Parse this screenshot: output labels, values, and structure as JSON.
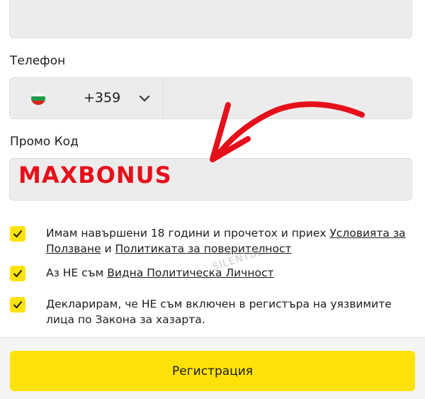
{
  "form": {
    "phone_label": "Телефон",
    "country_flag": "bulgaria-flag",
    "dial_code": "+359",
    "phone_value": "",
    "promo_label": "Промо Код",
    "promo_value": "MAXBONUS"
  },
  "checkboxes": [
    {
      "checked": true,
      "text_before": "Имам навършени 18 години и прочетох и приех ",
      "link1": "Условията за Ползване",
      "text_mid": " и ",
      "link2": "Политиката за поверителност"
    },
    {
      "checked": true,
      "text_before": "Аз НЕ съм ",
      "link1": "Видна Политическа Личност"
    },
    {
      "checked": true,
      "text_before": "Декларирам, че НЕ съм включен в регистъра на уязвимите лица по Закона за хазарта."
    }
  ],
  "watermark": "SILENTBET",
  "register_label": "Регистрация",
  "colors": {
    "accent": "#ffe20a",
    "promo_text": "#e5101a",
    "field_bg": "#ececec",
    "arrow": "#e5101a"
  }
}
